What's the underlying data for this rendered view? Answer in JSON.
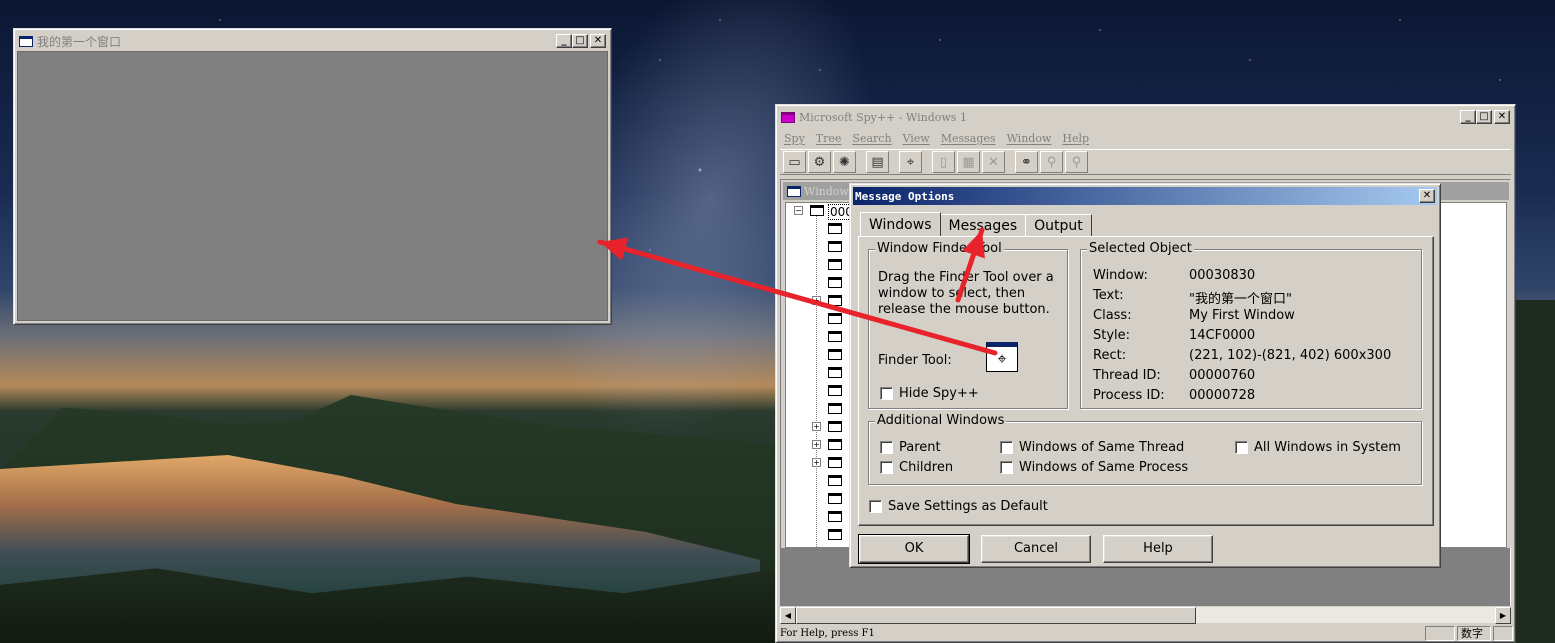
{
  "first_window": {
    "title": "我的第一个窗口",
    "minimize": "_",
    "maximize": "□",
    "close": "✕"
  },
  "spy": {
    "title": "Microsoft Spy++ - Windows 1",
    "menu": [
      "Spy",
      "Tree",
      "Search",
      "View",
      "Messages",
      "Window",
      "Help"
    ],
    "tree_title": "Windows",
    "tree_root": "000",
    "status_text": "For Help, press F1",
    "status_panes": [
      "",
      "数字",
      ""
    ],
    "toolbar_icons": [
      "windows-icon",
      "processes-icon",
      "threads-icon",
      "log-messages-icon",
      "find-window-icon",
      "stop-icon",
      "properties-icon",
      "clear-icon",
      "binoculars-icon",
      "find-next-icon",
      "find-prev-icon"
    ]
  },
  "dialog": {
    "title": "Message Options",
    "tabs": [
      "Windows",
      "Messages",
      "Output"
    ],
    "active_tab": "Windows",
    "finder_group": "Window Finder Tool",
    "finder_instructions": "Drag the Finder Tool over a window to select, then release the mouse button.",
    "finder_tool_label": "Finder Tool:",
    "hide_spy": "Hide Spy++",
    "selected_group": "Selected Object",
    "selected": [
      {
        "label": "Window:",
        "value": "00030830"
      },
      {
        "label": "Text:",
        "value": "\"我的第一个窗口\""
      },
      {
        "label": "Class:",
        "value": "My First Window"
      },
      {
        "label": "Style:",
        "value": "14CF0000"
      },
      {
        "label": "Rect:",
        "value": "(221, 102)-(821, 402) 600x300"
      },
      {
        "label": "Thread ID:",
        "value": "00000760"
      },
      {
        "label": "Process ID:",
        "value": "00000728"
      }
    ],
    "additional_group": "Additional Windows",
    "additional": {
      "parent": "Parent",
      "children": "Children",
      "same_thread": "Windows of Same Thread",
      "same_process": "Windows of Same Process",
      "all_windows": "All Windows in System"
    },
    "save_default": "Save Settings as Default",
    "ok": "OK",
    "cancel": "Cancel",
    "help": "Help"
  },
  "colors": {
    "arrow": "#e8232b",
    "dialog_face": "#d4d0c8",
    "title_active": "#0a246a",
    "client_gray": "#808080"
  }
}
